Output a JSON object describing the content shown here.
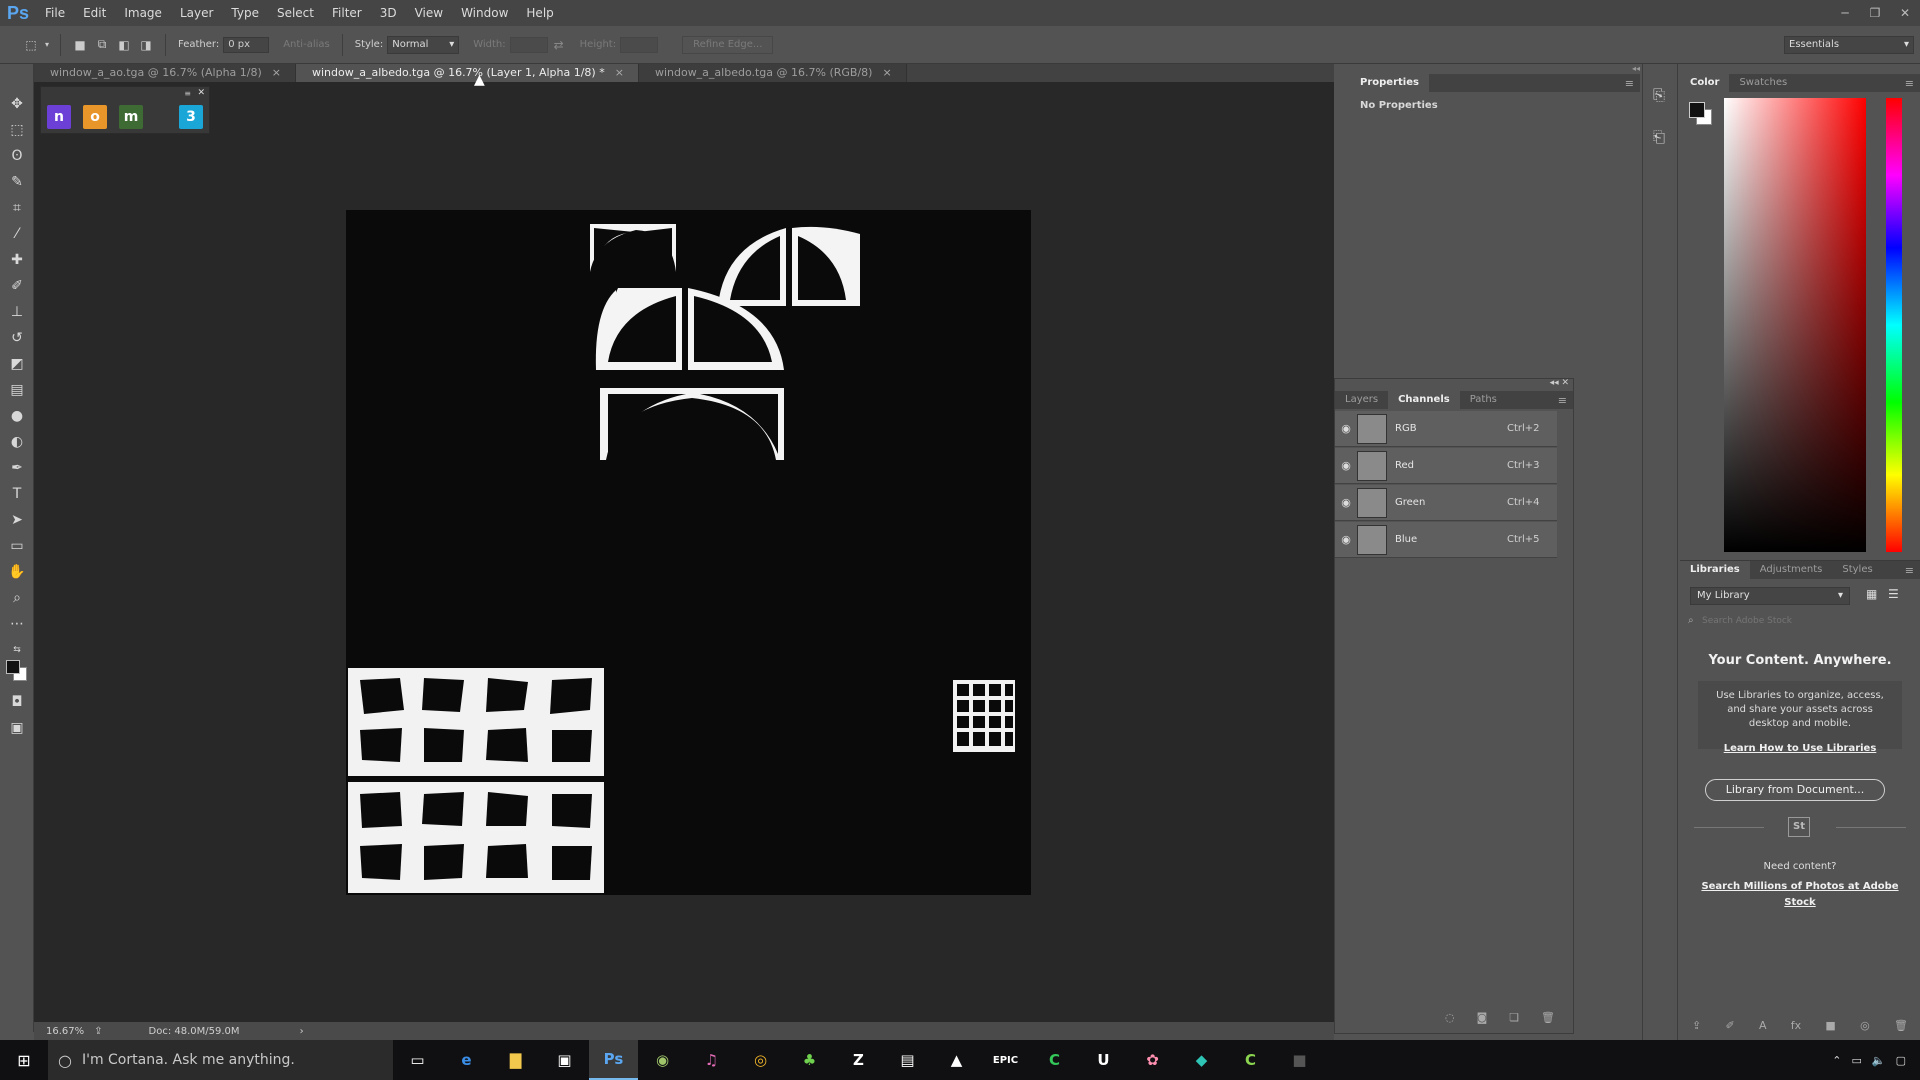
{
  "app": {
    "logo": "Ps",
    "menu": [
      "File",
      "Edit",
      "Image",
      "Layer",
      "Type",
      "Select",
      "Filter",
      "3D",
      "View",
      "Window",
      "Help"
    ],
    "window_controls": [
      "minimize-icon",
      "restore-icon",
      "close-icon"
    ]
  },
  "options_bar": {
    "feather_label": "Feather:",
    "feather_value": "0 px",
    "antialias_label": "Anti-alias",
    "style_label": "Style:",
    "style_value": "Normal",
    "width_label": "Width:",
    "height_label": "Height:",
    "refine_edge": "Refine Edge...",
    "workspace": "Essentials"
  },
  "tabs": [
    {
      "label": "window_a_ao.tga @ 16.7% (Alpha 1/8)",
      "close": "×",
      "active": false
    },
    {
      "label": "window_a_albedo.tga @ 16.7% (Layer 1, Alpha 1/8) *",
      "close": "×",
      "active": true
    },
    {
      "label": "window_a_albedo.tga @ 16.7% (RGB/8)",
      "close": "×",
      "active": false
    }
  ],
  "mini_panel": {
    "apps": [
      {
        "glyph": "n",
        "color": "#6c3fd6"
      },
      {
        "glyph": "o",
        "color": "#e8962a"
      },
      {
        "glyph": "m",
        "color": "#3e6b33"
      },
      {
        "glyph": "3",
        "color": "#1aa7d8"
      }
    ]
  },
  "status": {
    "zoom": "16.67%",
    "doc": "Doc: 48.0M/59.0M"
  },
  "properties": {
    "tab": "Properties",
    "message": "No Properties"
  },
  "channels_panel": {
    "tabs": [
      "Layers",
      "Channels",
      "Paths"
    ],
    "active_tab": "Channels",
    "rows": [
      {
        "name": "RGB",
        "shortcut": "Ctrl+2"
      },
      {
        "name": "Red",
        "shortcut": "Ctrl+3"
      },
      {
        "name": "Green",
        "shortcut": "Ctrl+4"
      },
      {
        "name": "Blue",
        "shortcut": "Ctrl+5"
      }
    ]
  },
  "color_panel": {
    "tabs": [
      "Color",
      "Swatches"
    ],
    "active_tab": "Color",
    "foreground": "#111111",
    "background": "#ffffff"
  },
  "libraries": {
    "tabs": [
      "Libraries",
      "Adjustments",
      "Styles"
    ],
    "active_tab": "Libraries",
    "library_select": "My Library",
    "search_placeholder": "Search Adobe Stock",
    "headline": "Your Content. Anywhere.",
    "body": "Use Libraries to organize, access, and share your assets across desktop and mobile.",
    "learn_link": "Learn How to Use Libraries",
    "from_document_button": "Library from Document...",
    "stock_badge": "St",
    "need_content": "Need content?",
    "stock_link": "Search Millions of Photos at Adobe Stock"
  },
  "taskbar": {
    "cortana_placeholder": "I'm Cortana. Ask me anything.",
    "apps": [
      {
        "name": "task-view-icon",
        "glyph": "▭"
      },
      {
        "name": "edge-icon",
        "glyph": "e"
      },
      {
        "name": "file-explorer-icon",
        "glyph": "▇"
      },
      {
        "name": "store-icon",
        "glyph": "▣"
      },
      {
        "name": "photoshop-icon",
        "glyph": "Ps"
      },
      {
        "name": "app-icon-1",
        "glyph": "◉"
      },
      {
        "name": "itunes-icon",
        "glyph": "♫"
      },
      {
        "name": "chrome-icon",
        "glyph": "◎"
      },
      {
        "name": "app-icon-2",
        "glyph": "♣"
      },
      {
        "name": "zbrush-icon",
        "glyph": "Z"
      },
      {
        "name": "app-icon-3",
        "glyph": "▤"
      },
      {
        "name": "photos-icon",
        "glyph": "▲"
      },
      {
        "name": "epic-icon",
        "glyph": "EPIC"
      },
      {
        "name": "app-icon-4",
        "glyph": "C"
      },
      {
        "name": "unreal-icon",
        "glyph": "U"
      },
      {
        "name": "app-icon-5",
        "glyph": "✿"
      },
      {
        "name": "app-icon-6",
        "glyph": "◆"
      },
      {
        "name": "app-icon-7",
        "glyph": "C"
      },
      {
        "name": "app-icon-8",
        "glyph": "■"
      }
    ]
  },
  "colors": {
    "accent": "#5aa6f0",
    "panel": "#535353",
    "canvas_bg": "#282828",
    "document": "#0a0a0a"
  }
}
